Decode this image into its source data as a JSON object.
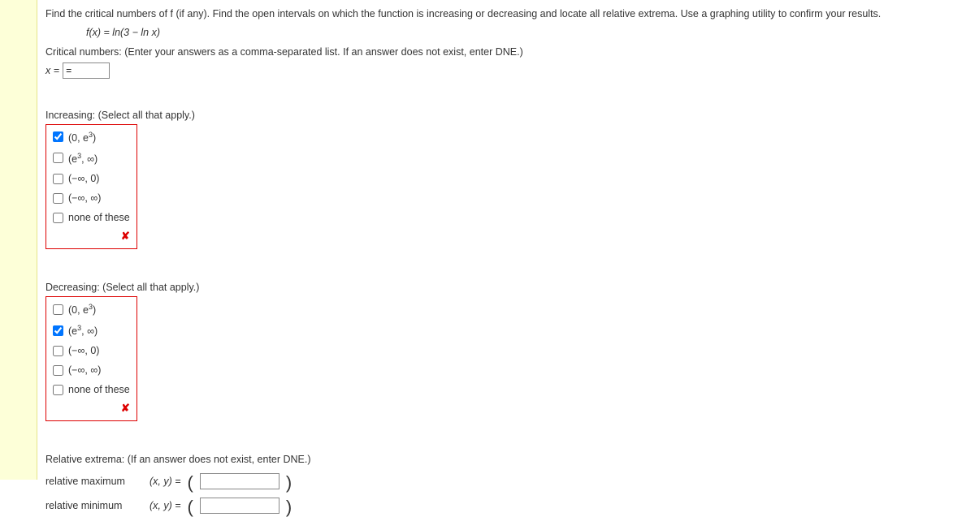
{
  "question": {
    "main": "Find the critical numbers of f (if any). Find the open intervals on which the function is increasing or decreasing and locate all relative extrema. Use a graphing utility to confirm your results.",
    "fx": "f(x) = ln(3 − ln x)"
  },
  "critical": {
    "label": "Critical numbers: (Enter your answers as a comma-separated list. If an answer does not exist, enter DNE.)",
    "x_eq": "x =",
    "value": "="
  },
  "increasing": {
    "label": "Increasing: (Select all that apply.)",
    "options": [
      {
        "html": "(0, e³)",
        "checked": true
      },
      {
        "html": "(e³, ∞)",
        "checked": false
      },
      {
        "html": "(−∞, 0)",
        "checked": false
      },
      {
        "html": "(−∞, ∞)",
        "checked": false
      },
      {
        "html": "none of these",
        "checked": false
      }
    ],
    "mark": "✘"
  },
  "decreasing": {
    "label": "Decreasing: (Select all that apply.)",
    "options": [
      {
        "html": "(0, e³)",
        "checked": false
      },
      {
        "html": "(e³, ∞)",
        "checked": true
      },
      {
        "html": "(−∞, 0)",
        "checked": false
      },
      {
        "html": "(−∞, ∞)",
        "checked": false
      },
      {
        "html": "none of these",
        "checked": false
      }
    ],
    "mark": "✘"
  },
  "extrema": {
    "label": "Relative extrema: (If an answer does not exist, enter DNE.)",
    "max_label": "relative maximum",
    "min_label": "relative minimum",
    "xy_eq": "(x, y) =",
    "open_paren": "(",
    "close_paren": ")",
    "max_value": "",
    "min_value": ""
  }
}
